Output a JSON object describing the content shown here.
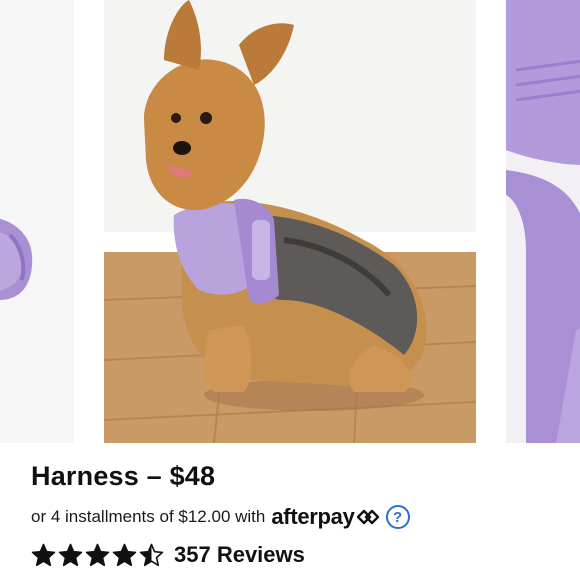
{
  "product": {
    "title": "Harness – $48",
    "installment_text": "or 4 installments of $12.00 with",
    "installment_provider": "afterpay",
    "help_glyph": "?",
    "rating": 4.5,
    "rating_max": 5,
    "reviews_label": "357 Reviews"
  },
  "carousel": {
    "slides": [
      {
        "name": "harness-closeup-left"
      },
      {
        "name": "yorkie-wearing-harness"
      },
      {
        "name": "harness-closeup-right"
      }
    ]
  },
  "colors": {
    "harness_lavender": "#b9a3dd",
    "floor_wood": "#c99a66",
    "wall": "#f4f4f2",
    "link_blue": "#2a6fd6",
    "text": "#111111"
  },
  "icons": {
    "afterpay": "afterpay-arrows-icon",
    "help": "question-circle-icon",
    "star_full": "star-filled-icon",
    "star_half": "star-half-icon"
  }
}
